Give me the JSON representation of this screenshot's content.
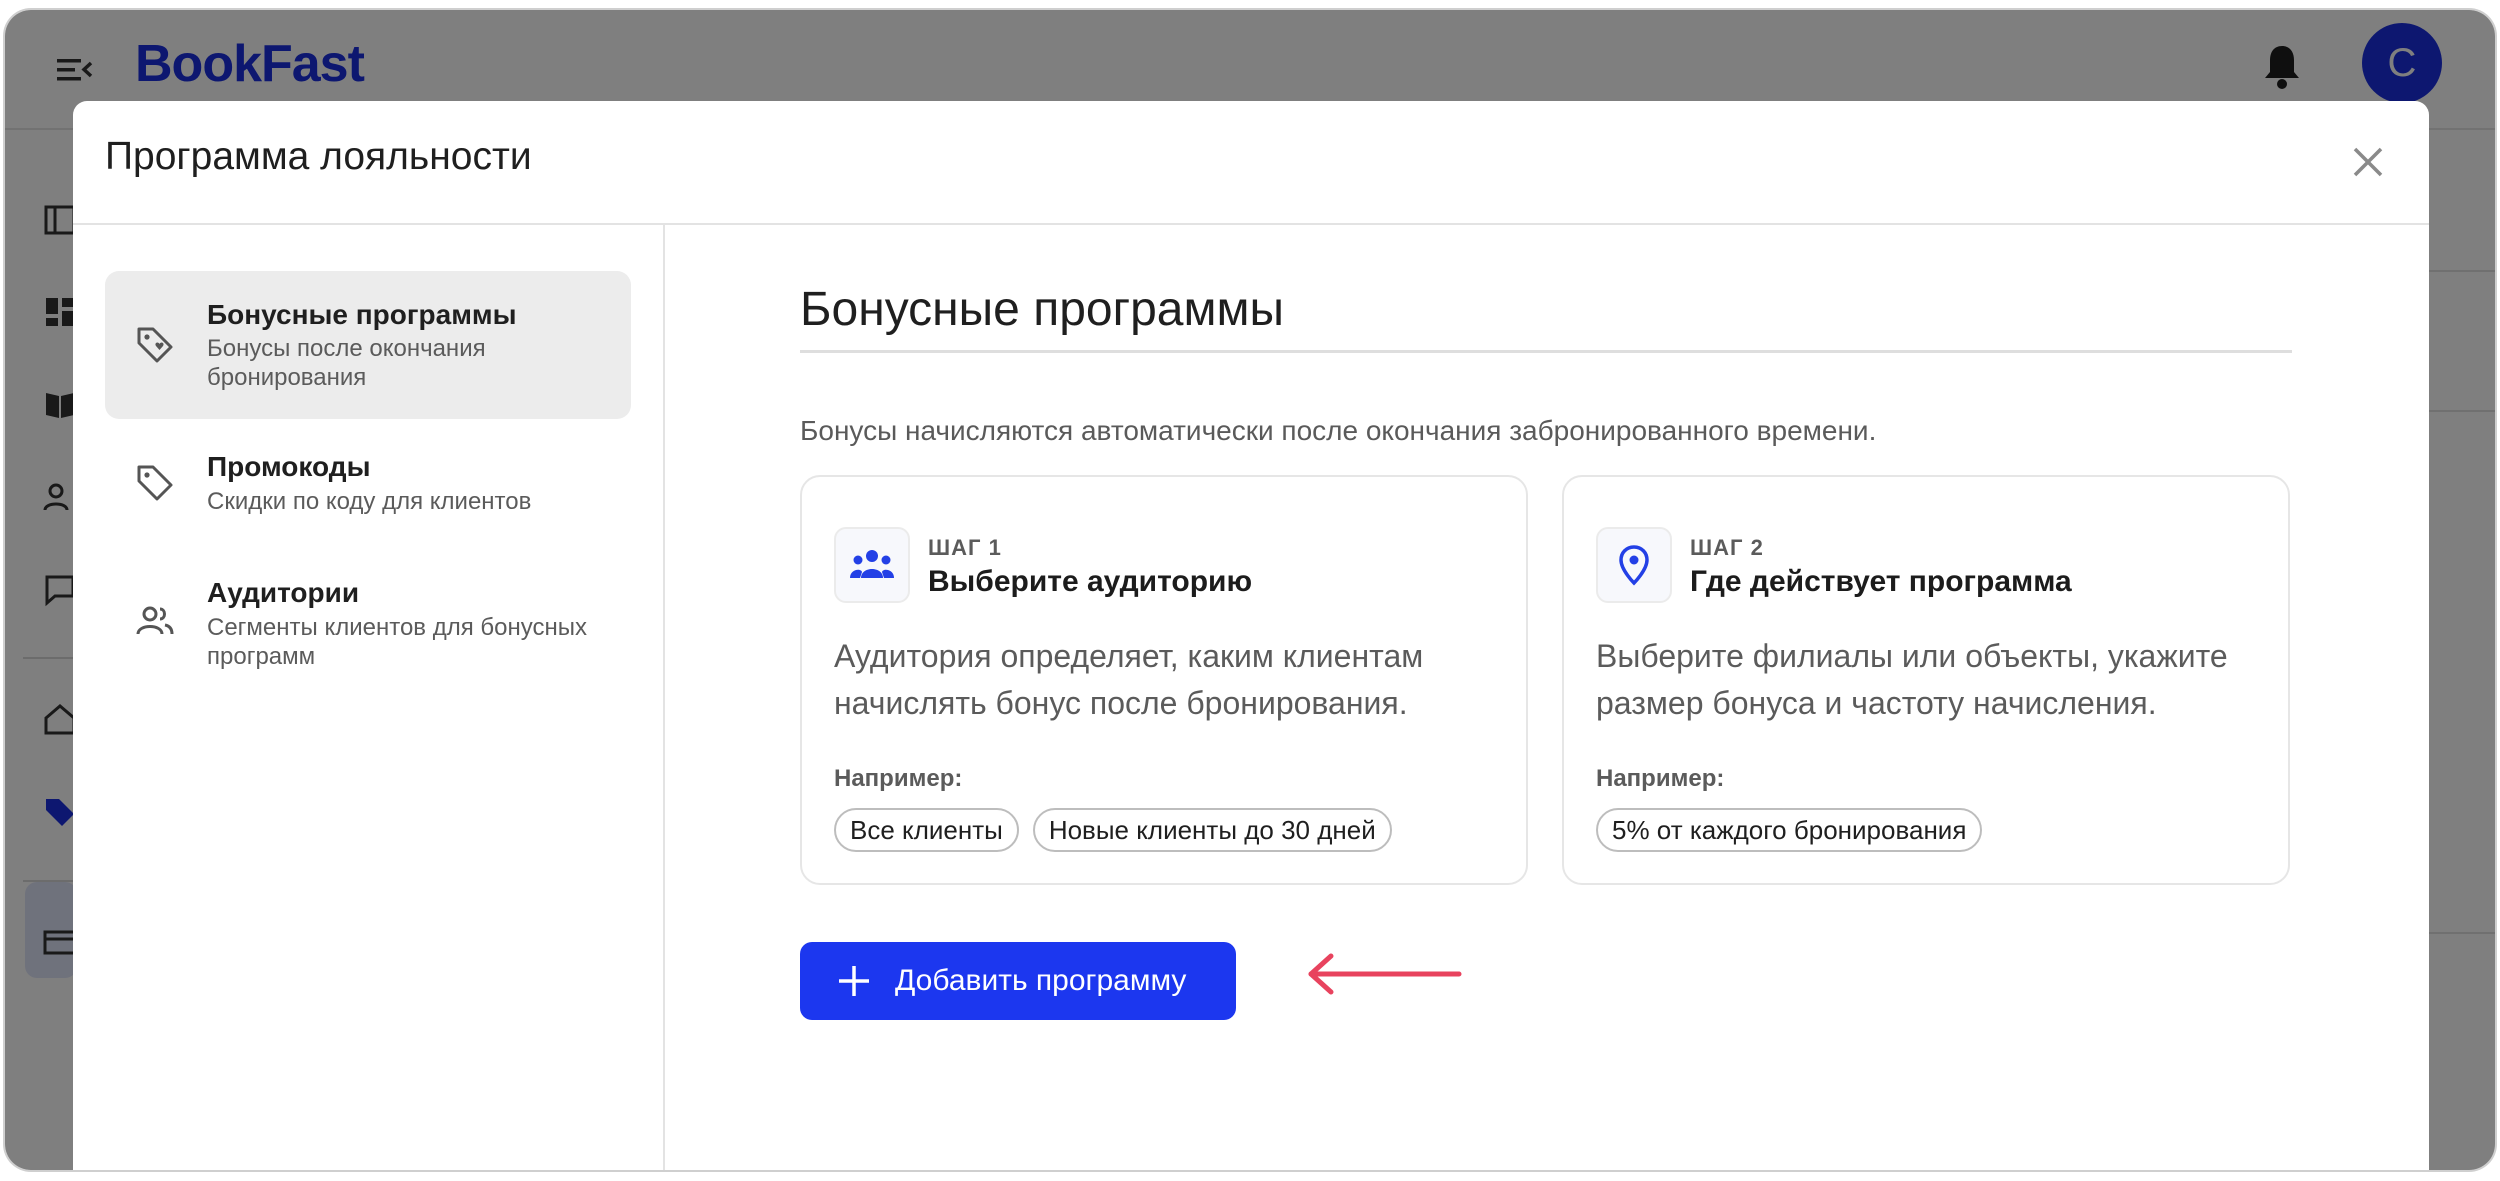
{
  "app": {
    "logo_text": "BookFast",
    "avatar_initial": "C"
  },
  "modal": {
    "title": "Программа лояльности",
    "close_label": "×"
  },
  "nav": {
    "items": [
      {
        "title": "Бонусные программы",
        "subtitle": "Бонусы после окончания бронирования",
        "icon": "tag-heart-icon",
        "active": true
      },
      {
        "title": "Промокоды",
        "subtitle": "Скидки по коду для клиентов",
        "icon": "tag-icon",
        "active": false
      },
      {
        "title": "Аудитории",
        "subtitle": "Сегменты клиентов для бонусных программ",
        "icon": "people-icon",
        "active": false
      }
    ]
  },
  "content": {
    "title": "Бонусные программы",
    "description": "Бонусы начисляются автоматически после окончания забронированного времени.",
    "steps": [
      {
        "label": "ШАГ 1",
        "title": "Выберите аудиторию",
        "description": "Аудитория определяет, каким клиентам начислять бонус после бронирования.",
        "example_label": "Например:",
        "examples": [
          "Все клиенты",
          "Новые клиенты до 30 дней"
        ],
        "icon": "group-icon"
      },
      {
        "label": "ШАГ 2",
        "title": "Где действует программа",
        "description": "Выберите филиалы или объекты, укажите размер бонуса и частоту начисления.",
        "example_label": "Например:",
        "examples": [
          "5% от каждого бронирования"
        ],
        "icon": "location-pin-icon"
      }
    ],
    "add_button_label": "Добавить программу"
  },
  "colors": {
    "accent": "#1c37ef",
    "brand": "#1a2fe0",
    "arrow": "#e8435e"
  }
}
